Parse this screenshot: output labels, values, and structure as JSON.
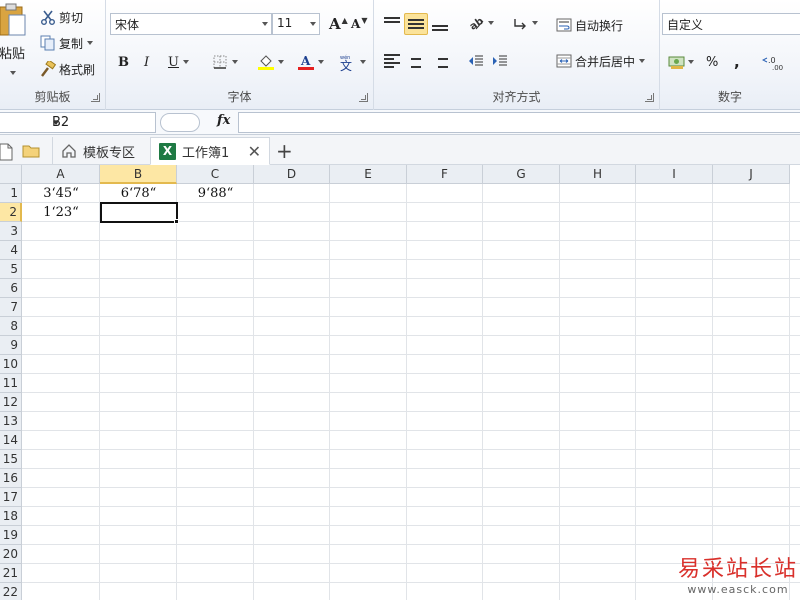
{
  "clipboard": {
    "paste_label": "粘贴",
    "cut_label": "剪切",
    "copy_label": "复制",
    "format_painter_label": "格式刷",
    "group_label": "剪贴板"
  },
  "font": {
    "font_name": "宋体",
    "font_size": "11",
    "grow_label": "A",
    "shrink_label": "A",
    "bold_label": "B",
    "italic_label": "I",
    "underline_label": "U",
    "phonetic_label": "文",
    "font_color": "#e52020",
    "fill_color": "#ffff00",
    "group_label": "字体"
  },
  "alignment": {
    "wrap_text_label": "自动换行",
    "merge_center_label": "合并后居中",
    "group_label": "对齐方式"
  },
  "number": {
    "format_value": "自定义",
    "percent_label": "%",
    "comma_label": ",",
    "increase_decimal_label": "0",
    "group_label": "数字"
  },
  "formula_bar": {
    "name_box": "B2",
    "fx_label": "fx",
    "formula": ""
  },
  "tabs": {
    "template_label": "模板专区",
    "workbook_label": "工作簿1",
    "excel_icon_letter": "X"
  },
  "grid": {
    "columns": [
      "A",
      "B",
      "C",
      "D",
      "E",
      "F",
      "G",
      "H",
      "I",
      "J"
    ],
    "selected_column": "B",
    "rows": [
      "1",
      "2",
      "3",
      "4",
      "5",
      "6",
      "7",
      "8",
      "9",
      "10",
      "11",
      "12",
      "13",
      "14",
      "15",
      "16",
      "17",
      "18",
      "19",
      "20",
      "21",
      "22"
    ],
    "selected_row": "2",
    "cells": {
      "A1": "3‘45“",
      "B1": "6‘78“",
      "C1": "9‘88“",
      "A2": "1‘23“"
    }
  },
  "watermark": {
    "main": "易采站长站",
    "sub": "www.easck.com"
  }
}
